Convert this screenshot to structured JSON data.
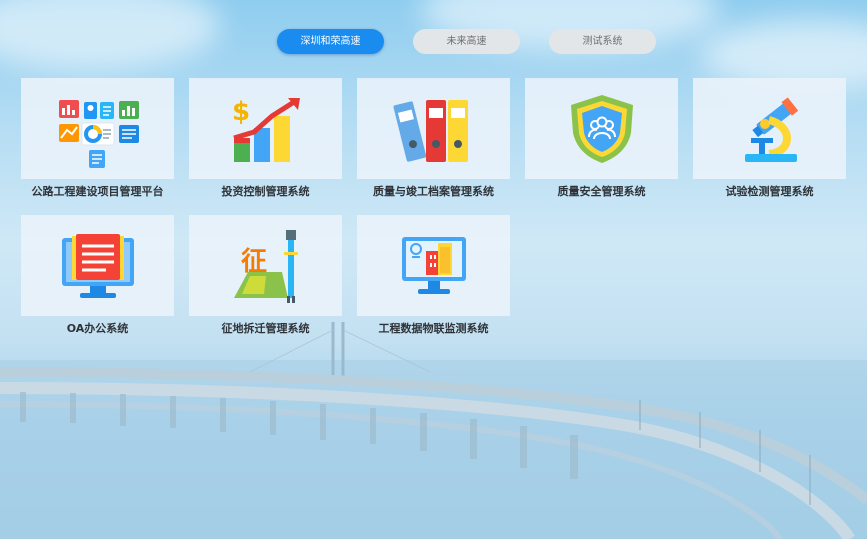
{
  "tabs": [
    {
      "label": "深圳和荣高速",
      "active": true
    },
    {
      "label": "未来高速",
      "active": false
    },
    {
      "label": "测试系统",
      "active": false
    }
  ],
  "systems": [
    {
      "label": "公路工程建设项目管理平台",
      "icon": "dashboard-icon"
    },
    {
      "label": "投资控制管理系统",
      "icon": "investment-chart-icon"
    },
    {
      "label": "质量与竣工档案管理系统",
      "icon": "archive-binders-icon"
    },
    {
      "label": "质量安全管理系统",
      "icon": "shield-icon"
    },
    {
      "label": "试验检测管理系统",
      "icon": "microscope-icon"
    },
    {
      "label": "OA办公系统",
      "icon": "office-monitor-icon"
    },
    {
      "label": "征地拆迁管理系统",
      "icon": "land-acquisition-icon"
    },
    {
      "label": "工程数据物联监测系统",
      "icon": "iot-monitor-icon"
    }
  ],
  "icon_glyphs": {
    "land": "征"
  },
  "colors": {
    "accent": "#1a8cf0",
    "tab_inactive": "#e3e6e9",
    "label": "#2f3338"
  }
}
